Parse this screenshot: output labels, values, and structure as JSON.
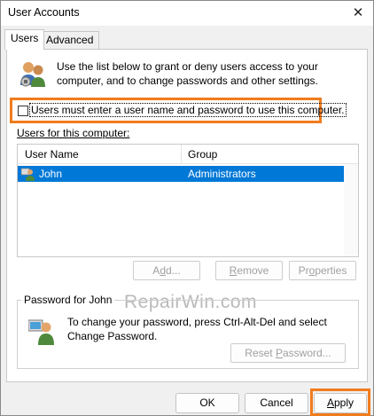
{
  "window": {
    "title": "User Accounts",
    "close_glyph": "✕"
  },
  "tabs": [
    {
      "label": "Users",
      "active": true
    },
    {
      "label": "Advanced",
      "active": false
    }
  ],
  "intro": {
    "icon": "users-group-icon",
    "text": "Use the list below to grant or deny users access to your computer, and to change passwords and other settings."
  },
  "must_login": {
    "label": "Users must enter a user name and password to use this computer.",
    "checked": false
  },
  "users_section": {
    "label": "Users for this computer:",
    "columns": [
      "User Name",
      "Group"
    ],
    "rows": [
      {
        "name": "John",
        "group": "Administrators",
        "selected": true
      }
    ]
  },
  "watermark": "RepairWin.com",
  "user_buttons": {
    "add_pre": "A",
    "add_ul": "d",
    "add_post": "d...",
    "remove_pre": "",
    "remove_ul": "R",
    "remove_post": "emove",
    "properties_pre": "Pr",
    "properties_ul": "o",
    "properties_post": "perties"
  },
  "password_group": {
    "legend": "Password for John",
    "text": "To change your password, press Ctrl-Alt-Del and select Change Password.",
    "reset_pre": "Reset ",
    "reset_ul": "P",
    "reset_post": "assword..."
  },
  "footer": {
    "ok": "OK",
    "cancel": "Cancel",
    "apply_ul": "A",
    "apply_post": "pply"
  },
  "colors": {
    "highlight": "#f07c1e",
    "selection": "#0078d7",
    "disabled_text": "#a0a0a0"
  }
}
